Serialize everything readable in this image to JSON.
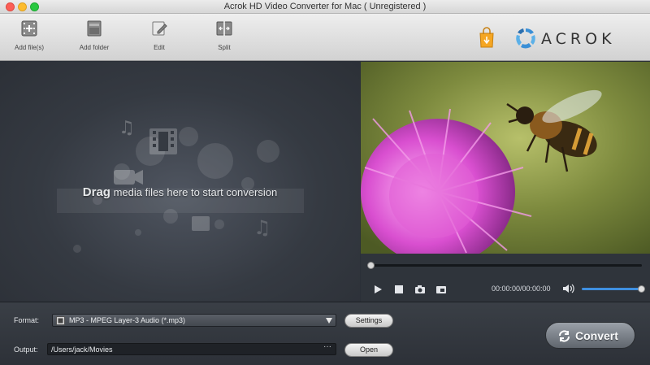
{
  "window": {
    "title": "Acrok HD Video Converter for Mac ( Unregistered )"
  },
  "toolbar": {
    "add_files": "Add file(s)",
    "add_folder": "Add folder",
    "edit": "Edit",
    "split": "Split"
  },
  "brand": {
    "logo_text": "ACROK",
    "accent_color": "#f5a623"
  },
  "droparea": {
    "text_bold": "Drag",
    "text_rest": " media files here to start conversion"
  },
  "player": {
    "timecode": "00:00:00/00:00:00",
    "seek_fraction": 0,
    "volume_fraction": 1
  },
  "bottom": {
    "format_label": "Format:",
    "format_value": "MP3 - MPEG Layer-3 Audio (*.mp3)",
    "settings_label": "Settings",
    "output_label": "Output:",
    "output_value": "/Users/jack/Movies",
    "output_browse": "···",
    "open_label": "Open",
    "convert_label": "Convert"
  },
  "icons": {
    "add_files": "film-add-icon",
    "add_folder": "folder-icon",
    "edit": "edit-icon",
    "split": "split-icon",
    "play": "play-icon",
    "stop": "stop-icon",
    "snapshot": "camera-icon",
    "fullscreen": "fullscreen-icon",
    "volume": "volume-icon",
    "convert": "convert-refresh-icon"
  }
}
